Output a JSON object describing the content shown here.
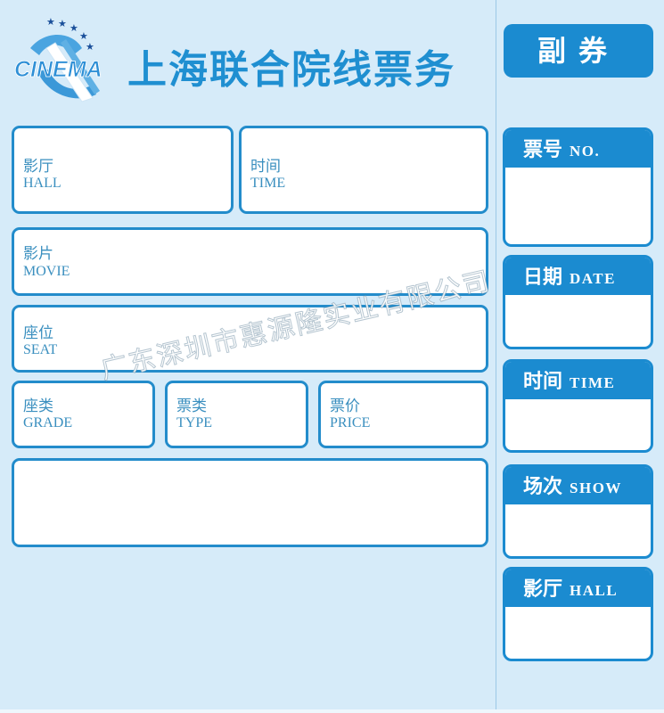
{
  "header": {
    "logo_text": "CINEMA",
    "title": "上海联合院线票务"
  },
  "main_ticket": {
    "fields": {
      "hall": {
        "zh": "影厅",
        "en": "HALL"
      },
      "time": {
        "zh": "时间",
        "en": "TIME"
      },
      "movie": {
        "zh": "影片",
        "en": "MOVIE"
      },
      "seat": {
        "zh": "座位",
        "en": "SEAT"
      },
      "grade": {
        "zh": "座类",
        "en": "GRADE"
      },
      "type": {
        "zh": "票类",
        "en": "TYPE"
      },
      "price": {
        "zh": "票价",
        "en": "PRICE"
      },
      "notes": {
        "zh": "",
        "en": ""
      }
    }
  },
  "stub": {
    "title": "副券",
    "fields": [
      {
        "zh": "票号",
        "en": "NO."
      },
      {
        "zh": "日期",
        "en": "DATE"
      },
      {
        "zh": "时间",
        "en": "TIME"
      },
      {
        "zh": "场次",
        "en": "SHOW"
      },
      {
        "zh": "影厅",
        "en": "HALL"
      }
    ]
  },
  "watermark": "广东深圳市惠源隆实业有限公司",
  "colors": {
    "background": "#d6ebf9",
    "accent": "#1b8bd0",
    "label": "#3a8fbf"
  }
}
